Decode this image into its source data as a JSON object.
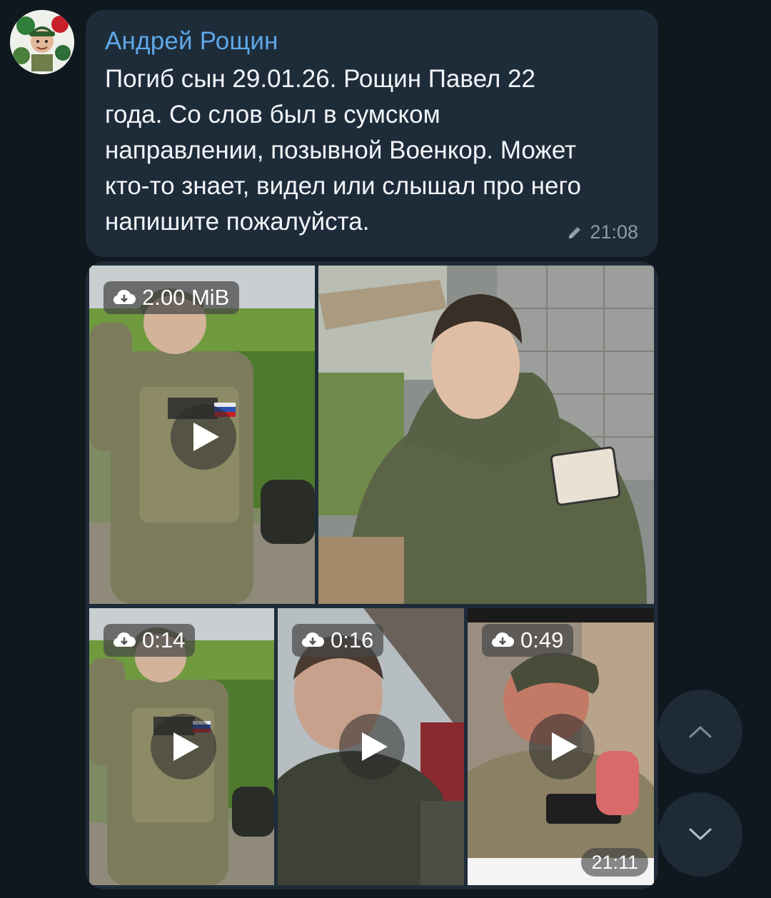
{
  "message": {
    "sender": "Андрей Рощин",
    "text": "Погиб сын 29.01.26. Рощин Павел 22\nгода. Со слов был в сумском\nнаправлении, позывной Военкор. Может\nкто-то знает, видел или слышал про него\nнапишите пожалуйста.",
    "time": "21:08",
    "edited_icon": "pencil-icon"
  },
  "album": {
    "items": [
      {
        "type": "video",
        "badge": "2.00 MiB",
        "icon": "download-icon"
      },
      {
        "type": "photo"
      },
      {
        "type": "video",
        "badge": "0:14",
        "icon": "download-icon"
      },
      {
        "type": "video",
        "badge": "0:16",
        "icon": "download-icon"
      },
      {
        "type": "video",
        "badge": "0:49",
        "icon": "download-icon"
      }
    ],
    "time": "21:11"
  },
  "controls": {
    "scroll_up_icon": "chevron-up-icon",
    "scroll_down_icon": "chevron-down-icon"
  },
  "colors": {
    "background": "#0f171f",
    "bubble": "#1e2c3a",
    "sender": "#5fa8e8",
    "text": "#f2f5f8",
    "meta": "#8d9aa6"
  }
}
